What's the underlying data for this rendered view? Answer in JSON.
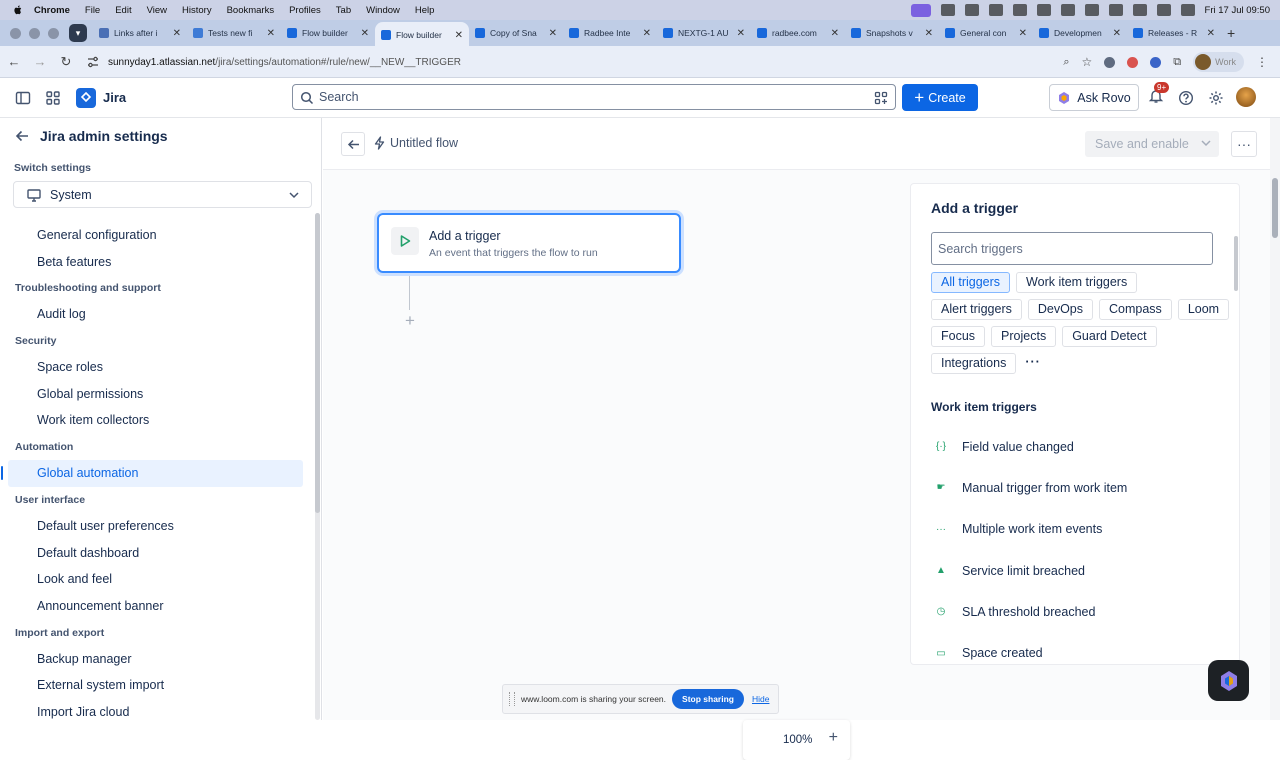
{
  "macos": {
    "app": "Chrome",
    "menus": [
      "File",
      "Edit",
      "View",
      "History",
      "Bookmarks",
      "Profiles",
      "Tab",
      "Window",
      "Help"
    ],
    "clock": "Fri 17 Jul  09:50"
  },
  "browser": {
    "tabs": [
      {
        "title": "Links after i",
        "color": "#4a6fb5"
      },
      {
        "title": "Tests new fi",
        "color": "#3e7bd6"
      },
      {
        "title": "Flow builder",
        "color": "#1868db"
      },
      {
        "title": "Flow builder",
        "color": "#1868db",
        "active": true
      },
      {
        "title": "Copy of Sna",
        "color": "#1868db"
      },
      {
        "title": "Radbee Inte",
        "color": "#1868db"
      },
      {
        "title": "NEXTG-1 AU",
        "color": "#1868db"
      },
      {
        "title": "radbee.com",
        "color": "#1868db"
      },
      {
        "title": "Snapshots v",
        "color": "#1868db"
      },
      {
        "title": "General con",
        "color": "#1868db"
      },
      {
        "title": "Developmen",
        "color": "#1868db"
      },
      {
        "title": "Releases - R",
        "color": "#1868db"
      }
    ],
    "url_domain": "sunnyday1.atlassian.net",
    "url_path": "/jira/settings/automation#/rule/new/__NEW__TRIGGER",
    "profile": "Work"
  },
  "jira": {
    "product": "Jira",
    "search_placeholder": "Search",
    "create_label": "Create",
    "ask_rovo_label": "Ask Rovo",
    "notifications_badge": "9+"
  },
  "sidebar": {
    "title": "Jira admin settings",
    "switch_label": "Switch settings",
    "switch_value": "System",
    "nav": [
      {
        "type": "item",
        "label": "General configuration"
      },
      {
        "type": "item",
        "label": "Beta features"
      },
      {
        "type": "section",
        "label": "Troubleshooting and support"
      },
      {
        "type": "item",
        "label": "Audit log"
      },
      {
        "type": "section",
        "label": "Security"
      },
      {
        "type": "item",
        "label": "Space roles"
      },
      {
        "type": "item",
        "label": "Global permissions"
      },
      {
        "type": "item",
        "label": "Work item collectors"
      },
      {
        "type": "section",
        "label": "Automation"
      },
      {
        "type": "item",
        "label": "Global automation",
        "selected": true
      },
      {
        "type": "section",
        "label": "User interface"
      },
      {
        "type": "item",
        "label": "Default user preferences"
      },
      {
        "type": "item",
        "label": "Default dashboard"
      },
      {
        "type": "item",
        "label": "Look and feel"
      },
      {
        "type": "item",
        "label": "Announcement banner"
      },
      {
        "type": "section",
        "label": "Import and export"
      },
      {
        "type": "item",
        "label": "Backup manager"
      },
      {
        "type": "item",
        "label": "External system import"
      },
      {
        "type": "item",
        "label": "Import Jira cloud"
      }
    ]
  },
  "flow": {
    "title": "Untitled flow",
    "save_label": "Save and enable",
    "trigger_card": {
      "title": "Add a trigger",
      "subtitle": "An event that triggers the flow to run"
    },
    "zoom": "100%"
  },
  "trigger_panel": {
    "title": "Add a trigger",
    "search_placeholder": "Search triggers",
    "filters": [
      {
        "label": "All triggers",
        "selected": true
      },
      {
        "label": "Work item triggers"
      },
      {
        "label": "Alert triggers"
      },
      {
        "label": "DevOps"
      },
      {
        "label": "Compass"
      },
      {
        "label": "Loom"
      },
      {
        "label": "Focus"
      },
      {
        "label": "Projects"
      },
      {
        "label": "Guard Detect"
      },
      {
        "label": "Integrations"
      }
    ],
    "section_title": "Work item triggers",
    "triggers": [
      {
        "label": "Field value changed",
        "icon": "field-change-icon",
        "glyph": "{·}"
      },
      {
        "label": "Manual trigger from work item",
        "icon": "hand-pointer-icon",
        "glyph": "☛"
      },
      {
        "label": "Multiple work item events",
        "icon": "dots-icon",
        "glyph": "···"
      },
      {
        "label": "Service limit breached",
        "icon": "warning-icon",
        "glyph": "▲"
      },
      {
        "label": "SLA threshold breached",
        "icon": "clock-icon",
        "glyph": "◷"
      },
      {
        "label": "Space created",
        "icon": "folder-icon",
        "glyph": "▭"
      }
    ]
  },
  "loom": {
    "message": "www.loom.com is sharing your screen.",
    "stop_label": "Stop sharing",
    "hide_label": "Hide"
  },
  "colors": {
    "brand": "#0c66e4",
    "accent_green": "#22a06b"
  }
}
